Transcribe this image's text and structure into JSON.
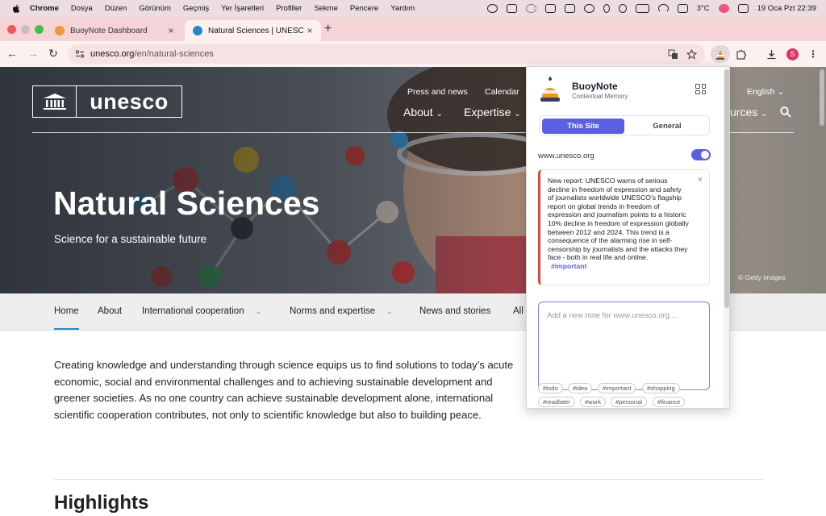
{
  "menubar": {
    "app": "Chrome",
    "items": [
      "Dosya",
      "Düzen",
      "Görünüm",
      "Geçmiş",
      "Yer İşaretleri",
      "Profiller",
      "Sekme",
      "Pencere",
      "Yardım"
    ],
    "weather": "3°C",
    "clock": "19 Oca Pzt  22:39"
  },
  "tabs": [
    {
      "title": "BuoyNote Dashboard",
      "close": "×"
    },
    {
      "title": "Natural Sciences | UNESCO",
      "close": "×"
    }
  ],
  "toolbar": {
    "new_tab": "+",
    "back": "←",
    "forward": "→",
    "reload": "↻",
    "url_host": "unesco.org",
    "url_path": "/en/natural-sciences",
    "profile_initial": "S"
  },
  "site": {
    "logo_text": "unesco",
    "top_links": [
      "Press and news",
      "Calendar"
    ],
    "language": "English",
    "main_nav": [
      "About",
      "Expertise"
    ],
    "main_nav_partial": "urces",
    "hero_title": "Natural Sciences",
    "hero_subtitle": "Science for a sustainable future",
    "credit": "© Getty images",
    "subnav": [
      "Home",
      "About",
      "International cooperation",
      "Norms and expertise",
      "News and stories",
      "All"
    ],
    "intro": "Creating knowledge and understanding through science equips us to find solutions to today’s acute economic, social and environmental challenges and to achieving sustainable development and greener societies. As no one country can achieve sustainable development alone, international scientific cooperation contributes, not only to scientific knowledge but also to building peace.",
    "highlights": "Highlights"
  },
  "popup": {
    "title": "BuoyNote",
    "subtitle": "Contextual Memory",
    "tab_this_site": "This Site",
    "tab_general": "General",
    "domain": "www.unesco.org",
    "toggle_on": true,
    "note_text": "New report: UNESCO warns of serious decline in freedom of expression and safety of journalists worldwide UNESCO’s flagship report on global trends in freedom of expression and journalism points to a historic 10% decline in freedom of expression globally between 2012 and 2024. This trend is a consequence of the alarming rise in self-censorship by journalists and the attacks they face - both in real life and online.",
    "note_tag": "#important",
    "note_close": "×",
    "placeholder": "Add a new note for www.unesco.org....",
    "tags": [
      "#todo",
      "#idea",
      "#important",
      "#shopping",
      "#readlater",
      "#work",
      "#personal",
      "#finance"
    ]
  },
  "colors": {
    "accent": "#5b5fe4",
    "note_border": "#d84a3a",
    "tab_strip": "#f5d4d8",
    "menubar": "#ecdde0"
  }
}
